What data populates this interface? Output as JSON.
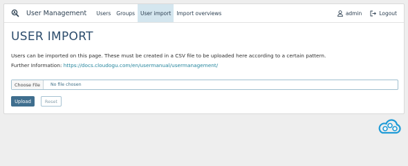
{
  "nav": {
    "brand_icon": "search-user-icon",
    "title": "User Management",
    "items": [
      {
        "label": "Users",
        "active": false
      },
      {
        "label": "Groups",
        "active": false
      },
      {
        "label": "User import",
        "active": true
      },
      {
        "label": "Import overviews",
        "active": false
      }
    ],
    "user_icon": "user-icon",
    "user": "admin",
    "logout_icon": "logout-icon",
    "logout": "Logout"
  },
  "page": {
    "title": "USER IMPORT",
    "description": "Users can be imported on this page. These must be created in a CSV file to be uploaded here according to a certain pattern.",
    "info_label": "Further Information:",
    "info_link": "https://docs.cloudogu.com/en/usermanual/usermanagement/"
  },
  "file_input": {
    "button_label": "Choose File",
    "status": "No file chosen"
  },
  "buttons": {
    "upload": "Upload",
    "reset": "Reset"
  },
  "footer": {
    "logo_icon": "cloudogu-logo-icon"
  },
  "colors": {
    "accent": "#3f6e8e",
    "nav_active": "#d4e6ef",
    "title": "#2c4c6c",
    "link": "#23849c",
    "logo": "#1f9bd7"
  }
}
